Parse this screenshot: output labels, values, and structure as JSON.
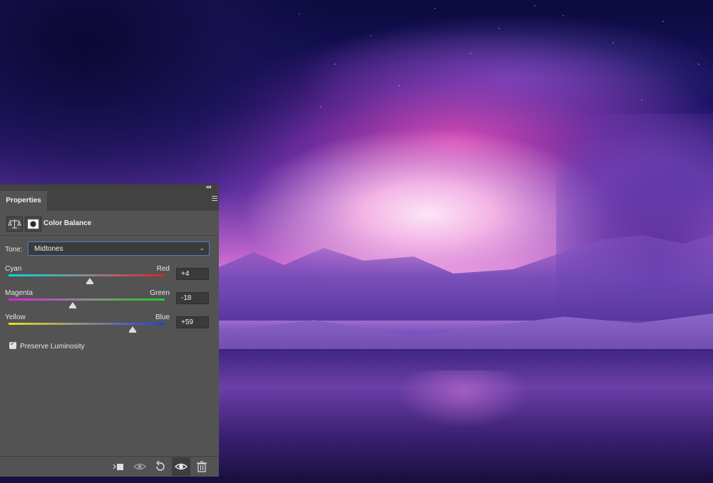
{
  "panel": {
    "tab_label": "Properties",
    "adjustment_title": "Color Balance",
    "tone": {
      "label": "Tone:",
      "value": "Midtones"
    },
    "sliders": [
      {
        "left_label": "Cyan",
        "right_label": "Red",
        "value": "+4",
        "amount": 4,
        "left_color": "#00d8e6",
        "right_color": "#e0202a"
      },
      {
        "left_label": "Magenta",
        "right_label": "Green",
        "value": "-18",
        "amount": -18,
        "left_color": "#e020e0",
        "right_color": "#20d020"
      },
      {
        "left_label": "Yellow",
        "right_label": "Blue",
        "value": "+59",
        "amount": 59,
        "left_color": "#e6e020",
        "right_color": "#2040e0"
      }
    ],
    "preserve_luminosity": {
      "label": "Preserve Luminosity",
      "checked": true
    },
    "footer_icons": [
      "clip-to-layer-icon",
      "view-previous-state-icon",
      "reset-icon",
      "toggle-visibility-icon",
      "delete-icon"
    ]
  },
  "colors": {
    "panel_bg": "#535353",
    "tab_bar": "#424242",
    "focus": "#4a7fc4"
  }
}
